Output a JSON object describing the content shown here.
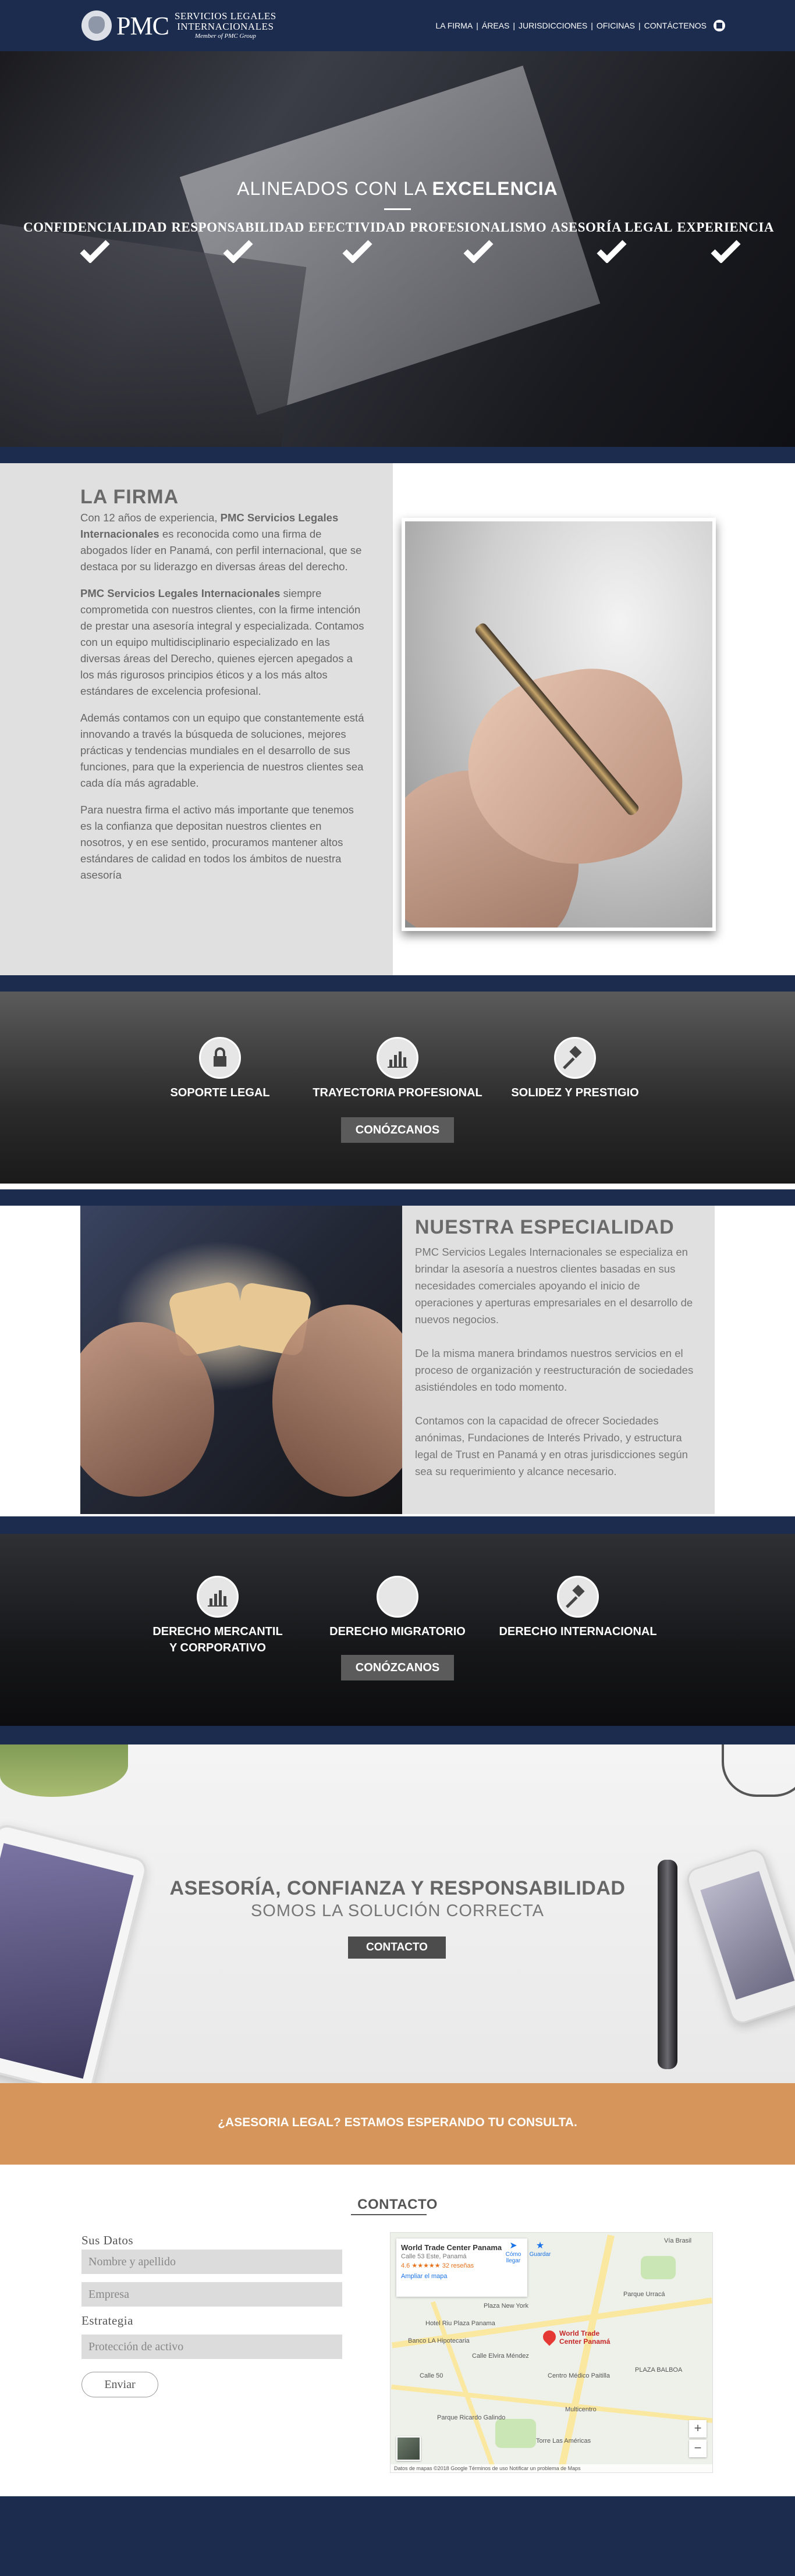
{
  "brand": {
    "short": "PMC",
    "line1": "SERVICIOS LEGALES",
    "line2": "INTERNACIONALES",
    "member": "Member of PMC Group"
  },
  "nav": {
    "items": [
      "LA FIRMA",
      "ÁREAS",
      "JURISDICCIONES",
      "OFICINAS",
      "CONTÁCTENOS"
    ],
    "separator": "|"
  },
  "hero": {
    "title_light": "ALINEADOS CON LA",
    "title_bold": "EXCELENCIA",
    "values": [
      "CONFIDENCIALIDAD",
      "RESPONSABILIDAD",
      "EFECTIVIDAD",
      "PROFESIONALISMO",
      "ASESORÍA LEGAL",
      "EXPERIENCIA"
    ]
  },
  "firma": {
    "title": "LA FIRMA",
    "p1_a": "Con 12 años de experiencia, ",
    "p1_strong": "PMC Servicios Legales Internacionales",
    "p1_b": " es reconocida como una firma de abogados líder en Panamá, con perfil internacional, que se destaca por su liderazgo en diversas áreas del derecho.",
    "p2_strong": "PMC Servicios Legales Internacionales",
    "p2_b": " siempre comprometida con nuestros clientes, con la firme intención de prestar una asesoría integral y especializada. Contamos con un equipo multidisciplinario especializado en las diversas áreas del Derecho, quienes ejercen apegados a los más rigurosos principios éticos y a los más altos estándares de excelencia profesional.",
    "p3": "Además contamos con un equipo que constantemente está innovando a través la búsqueda de soluciones, mejores prácticas y tendencias mundiales en el desarrollo de sus funciones, para que la experiencia de nuestros clientes sea cada día más agradable.",
    "p4": "Para nuestra firma el activo más importante que tenemos es la confianza que depositan nuestros clientes en nosotros, y en ese sentido, procuramos mantener altos estándares de calidad en todos los ámbitos de nuestra asesoría"
  },
  "features": {
    "items": [
      "SOPORTE LEGAL",
      "TRAYECTORIA PROFESIONAL",
      "SOLIDEZ Y PRESTIGIO"
    ],
    "button": "CONÓZCANOS"
  },
  "especialidad": {
    "title": "NUESTRA ESPECIALIDAD",
    "p1": "PMC Servicios Legales Internacionales se especializa en brindar la asesoría a nuestros clientes basadas en sus necesidades comerciales apoyando el inicio de operaciones y aperturas empresariales en el desarrollo de nuevos negocios.",
    "p2": "De la misma manera brindamos nuestros servicios en el proceso de organización y reestructuración de sociedades asistiéndoles en todo momento.",
    "p3": "Contamos con la capacidad de ofrecer Sociedades anónimas, Fundaciones de Interés Privado, y estructura legal de Trust en Panamá y en otras jurisdicciones según sea su requerimiento y alcance necesario."
  },
  "areas": {
    "item1_line1": "DERECHO MERCANTIL",
    "item1_line2": "Y CORPORATIVO",
    "item2": "DERECHO MIGRATORIO",
    "item3": "DERECHO INTERNACIONAL",
    "button": "CONÓZCANOS"
  },
  "banner": {
    "title": "ASESORÍA, CONFIANZA Y RESPONSABILIDAD",
    "subtitle": "SOMOS LA SOLUCIÓN CORRECTA",
    "button": "CONTACTO"
  },
  "cta": {
    "text": "¿ASESORIA LEGAL? ESTAMOS ESPERANDO TU CONSULTA."
  },
  "contact": {
    "heading": "CONTACTO",
    "label_data": "Sus Datos",
    "name_placeholder": "Nombre y apellido",
    "company_placeholder": "Empresa",
    "label_strategy": "Estrategia",
    "strategy_placeholder": "Protección de activo",
    "send": "Enviar"
  },
  "map": {
    "place": "World Trade Center Panama",
    "address": "Calle 53 Este, Panamá",
    "rating": "4.6 ★★★★★   32 reseñas",
    "link": "Ampliar el mapa",
    "directions": "Cómo llegar",
    "save": "Guardar",
    "pin_line1": "World Trade",
    "pin_line2": "Center Panamá",
    "labels": [
      "Vía Brasil",
      "Plaza New York",
      "Hotel Riu Plaza Panama",
      "Banco LA Hipotecaria",
      "Calle Elvira Méndez",
      "Centro Médico Paitilla",
      "Multicentro",
      "PLAZA BALBOA",
      "Parque Urracá",
      "Calle 50",
      "Parque Ricardo Galindo",
      "Torre Las Américas"
    ],
    "zoom_in": "+",
    "zoom_out": "−",
    "footer": "Datos de mapas ©2018 Google   Términos de uso   Notificar un problema de Maps"
  }
}
